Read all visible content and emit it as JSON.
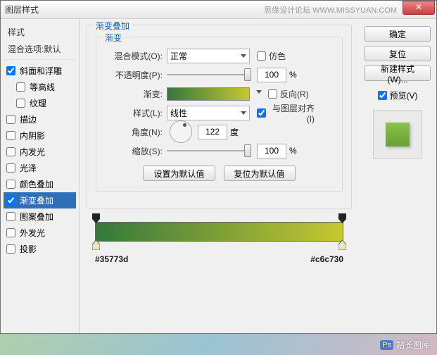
{
  "title": "图层样式",
  "watermark": "思缘设计论坛 WWW.MISSYUAN.COM",
  "sidebar": {
    "header": "样式",
    "sub": "混合选项:默认",
    "items": [
      {
        "label": "斜面和浮雕",
        "checked": true,
        "indent": false
      },
      {
        "label": "等高线",
        "checked": false,
        "indent": true
      },
      {
        "label": "纹理",
        "checked": false,
        "indent": true
      },
      {
        "label": "描边",
        "checked": false,
        "indent": false
      },
      {
        "label": "内阴影",
        "checked": false,
        "indent": false
      },
      {
        "label": "内发光",
        "checked": false,
        "indent": false
      },
      {
        "label": "光泽",
        "checked": false,
        "indent": false
      },
      {
        "label": "颜色叠加",
        "checked": false,
        "indent": false
      },
      {
        "label": "渐变叠加",
        "checked": true,
        "indent": false,
        "selected": true
      },
      {
        "label": "图案叠加",
        "checked": false,
        "indent": false
      },
      {
        "label": "外发光",
        "checked": false,
        "indent": false
      },
      {
        "label": "投影",
        "checked": false,
        "indent": false
      }
    ]
  },
  "panel": {
    "group_title": "渐变叠加",
    "sub_title": "渐变",
    "blend_label": "混合模式(O):",
    "blend_value": "正常",
    "dither": "仿色",
    "opacity_label": "不透明度(P):",
    "opacity_value": "100",
    "pct": "%",
    "gradient_label": "渐变:",
    "reverse": "反向(R)",
    "style_label": "样式(L):",
    "style_value": "线性",
    "align": "与图层对齐(I)",
    "angle_label": "角度(N):",
    "angle_value": "122",
    "angle_unit": "度",
    "scale_label": "缩放(S):",
    "scale_value": "100",
    "btn_default": "设置为默认值",
    "btn_reset": "复位为默认值"
  },
  "right": {
    "ok": "确定",
    "cancel": "复位",
    "new_style": "新建样式(W)...",
    "preview": "预览(V)"
  },
  "gradient": {
    "color_left": "#35773d",
    "color_right": "#c6c730"
  },
  "footer": "站长图库"
}
